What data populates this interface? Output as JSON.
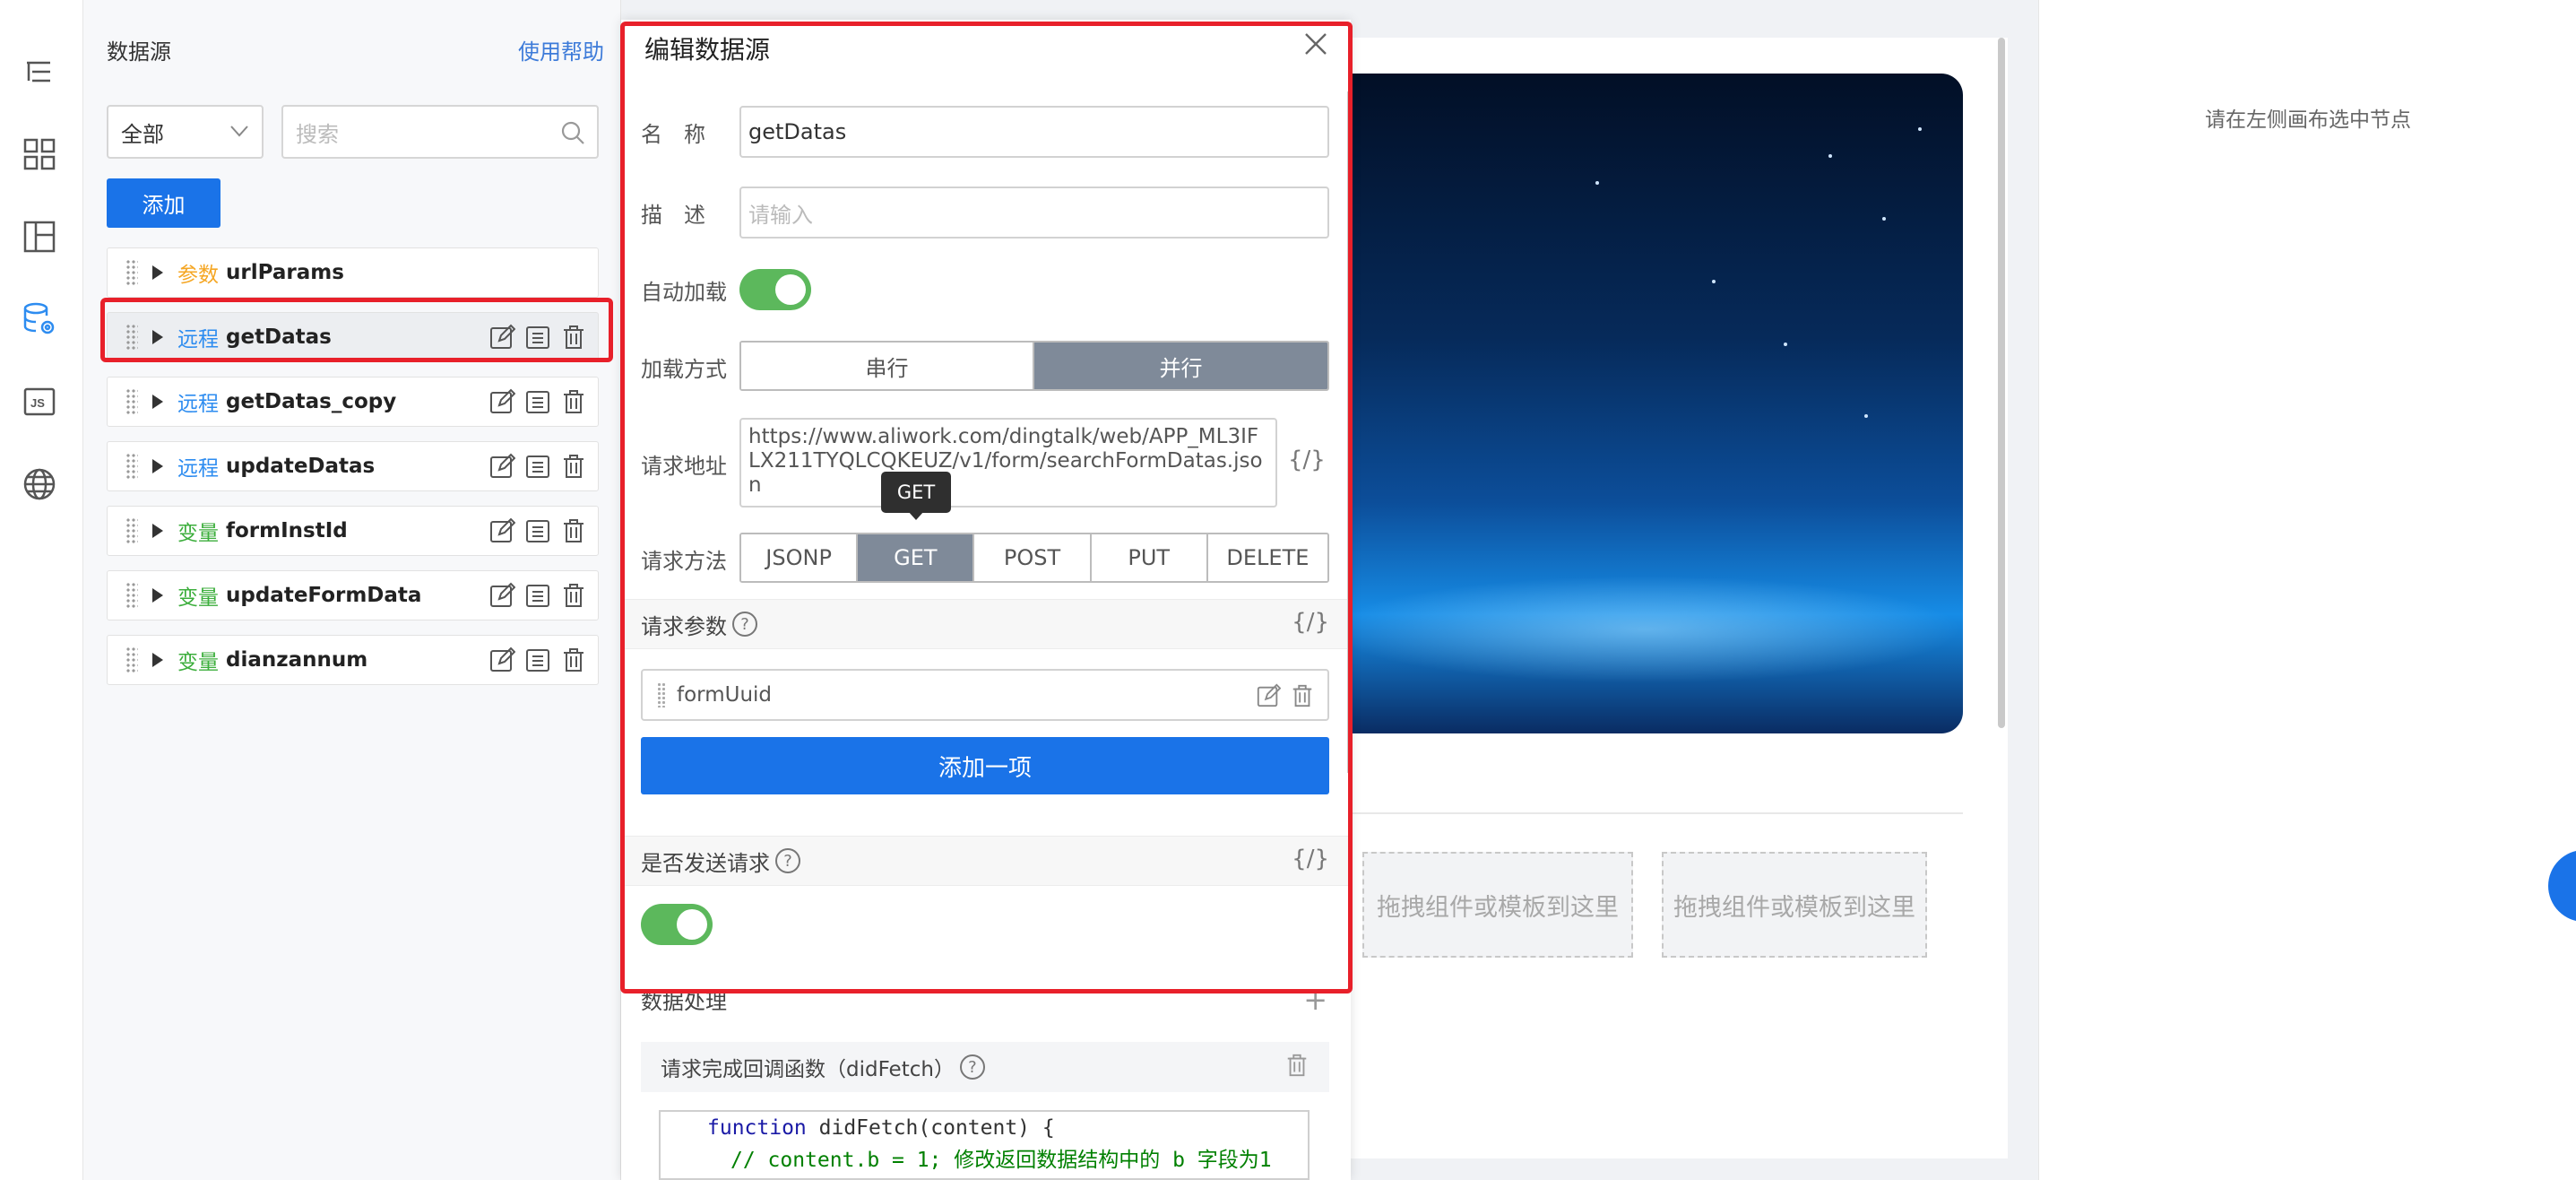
{
  "data_panel": {
    "title": "数据源",
    "help": "使用帮助",
    "filter_select": "全部",
    "search_placeholder": "搜索",
    "add_button": "添加",
    "items": [
      {
        "tag": "参数",
        "name": "urlParams"
      },
      {
        "tag": "远程",
        "name": "getDatas"
      },
      {
        "tag": "远程",
        "name": "getDatas_copy"
      },
      {
        "tag": "远程",
        "name": "updateDatas"
      },
      {
        "tag": "变量",
        "name": "formInstId"
      },
      {
        "tag": "变量",
        "name": "updateFormData"
      },
      {
        "tag": "变量",
        "name": "dianzannum"
      }
    ]
  },
  "dialog": {
    "title": "编辑数据源",
    "name_label": "名　称",
    "name_value": "getDatas",
    "desc_label": "描　述",
    "desc_placeholder": "请输入",
    "autoload_label": "自动加载",
    "load_mode_label": "加载方式",
    "load_modes": [
      "串行",
      "并行"
    ],
    "url_label": "请求地址",
    "url_value": "https://www.aliwork.com/dingtalk/web/APP_ML3IFLX211TYQLCQKEUZ/v1/form/searchFormDatas.json",
    "curly": "{/}",
    "tooltip": "GET",
    "method_label": "请求方法",
    "methods": [
      "JSONP",
      "GET",
      "POST",
      "PUT",
      "DELETE"
    ],
    "params_label": "请求参数",
    "param_item": "formUuid",
    "add_item_button": "添加一项",
    "send_label": "是否发送请求",
    "processing_label": "数据处理",
    "did_fetch_label": "请求完成回调函数（didFetch）",
    "code_line1_kw": "function",
    "code_line1_rest": " didFetch(content) {",
    "code_line2": "// content.b = 1; 修改返回数据结构中的 b 字段为1"
  },
  "canvas": {
    "drop_hint_1": "拖拽组件或模板到这里",
    "drop_hint_2": "拖拽组件或模板到这里"
  },
  "right_panel": {
    "hint": "请在左侧画布选中节点"
  },
  "colors": {
    "accent": "#1a73e8",
    "highlight": "#e8202a",
    "toggle_on": "#5cb85c",
    "tag_param": "#f5a623",
    "tag_remote": "#2d8cf0",
    "tag_var": "#3cae3c"
  }
}
